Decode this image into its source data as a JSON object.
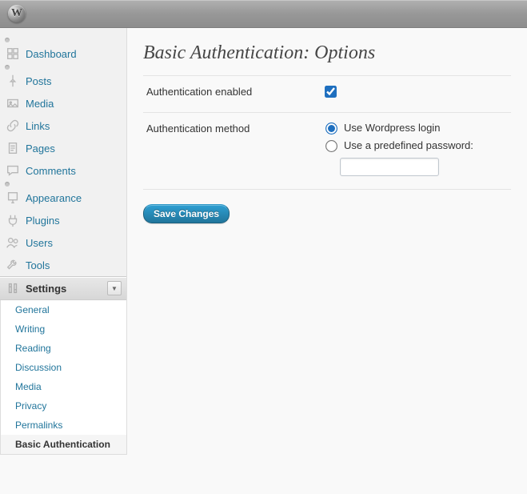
{
  "header": {
    "logo_letter": "W"
  },
  "sidebar": {
    "groups": [
      [
        {
          "id": "dashboard",
          "label": "Dashboard",
          "icon": "dashboard"
        }
      ],
      [
        {
          "id": "posts",
          "label": "Posts",
          "icon": "pin"
        },
        {
          "id": "media",
          "label": "Media",
          "icon": "media"
        },
        {
          "id": "links",
          "label": "Links",
          "icon": "link"
        },
        {
          "id": "pages",
          "label": "Pages",
          "icon": "page"
        },
        {
          "id": "comments",
          "label": "Comments",
          "icon": "comment"
        }
      ],
      [
        {
          "id": "appearance",
          "label": "Appearance",
          "icon": "appearance"
        },
        {
          "id": "plugins",
          "label": "Plugins",
          "icon": "plugin"
        },
        {
          "id": "users",
          "label": "Users",
          "icon": "users"
        },
        {
          "id": "tools",
          "label": "Tools",
          "icon": "tools"
        },
        {
          "id": "settings",
          "label": "Settings",
          "icon": "settings",
          "current": true,
          "expanded": true
        }
      ]
    ],
    "settings_submenu": [
      {
        "id": "general",
        "label": "General"
      },
      {
        "id": "writing",
        "label": "Writing"
      },
      {
        "id": "reading",
        "label": "Reading"
      },
      {
        "id": "discussion",
        "label": "Discussion"
      },
      {
        "id": "media-s",
        "label": "Media"
      },
      {
        "id": "privacy",
        "label": "Privacy"
      },
      {
        "id": "permalinks",
        "label": "Permalinks"
      },
      {
        "id": "basic-auth",
        "label": "Basic Authentication",
        "current": true
      }
    ]
  },
  "main": {
    "title": "Basic Authentication: Options",
    "rows": {
      "enabled_label": "Authentication enabled",
      "enabled_checked": true,
      "method_label": "Authentication method",
      "method_options": {
        "wp_login": "Use Wordpress login",
        "predefined": "Use a predefined password:"
      },
      "method_selected": "wp_login",
      "password_value": ""
    },
    "save_label": "Save Changes"
  }
}
